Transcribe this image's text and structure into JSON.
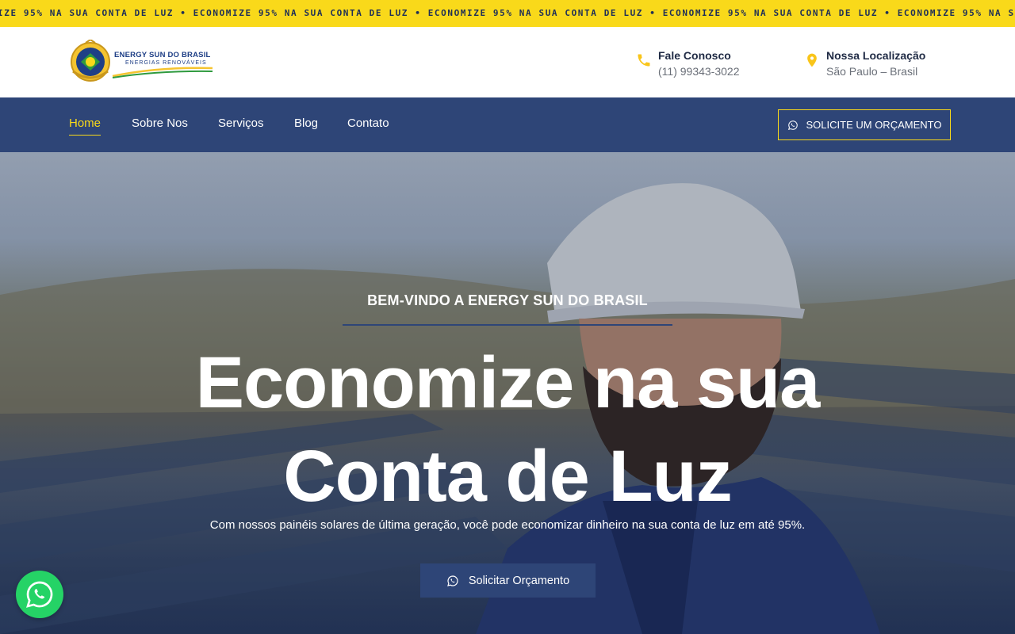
{
  "ticker": {
    "text": "IZE 95% NA SUA CONTA DE LUZ • ECONOMIZE 95% NA SUA CONTA DE LUZ • ECONOMIZE 95% NA SUA CONTA DE LUZ • ECONOMIZE 95% NA SUA CONTA DE LUZ • ECONOMIZE 95% NA SUA"
  },
  "brand": {
    "name": "ENERGY SUN DO BRASIL",
    "tagline": "ENERGIAS RENOVÁVEIS"
  },
  "contacts": {
    "phone": {
      "label": "Fale Conosco",
      "value": "(11) 99343-3022",
      "icon": "phone-icon"
    },
    "location": {
      "label": "Nossa Localização",
      "value": "São Paulo – Brasil",
      "icon": "map-pin-icon"
    }
  },
  "nav": {
    "items": [
      {
        "label": "Home",
        "active": true
      },
      {
        "label": "Sobre Nos",
        "active": false
      },
      {
        "label": "Serviços",
        "active": false
      },
      {
        "label": "Blog",
        "active": false
      },
      {
        "label": "Contato",
        "active": false
      }
    ],
    "cta_label": "SOLICITE UM ORÇAMENTO"
  },
  "hero": {
    "kicker": "BEM-VINDO A ENERGY SUN DO BRASIL",
    "title_line1": "Economize na sua",
    "title_line2": "Conta de Luz",
    "subtitle": "Com nossos painéis solares de última geração, você pode economizar dinheiro na sua conta de luz em até 95%.",
    "button_label": "Solicitar Orçamento"
  },
  "colors": {
    "accent_yellow": "#f9d91a",
    "navy": "#2e4577",
    "whatsapp_green": "#25d366"
  }
}
